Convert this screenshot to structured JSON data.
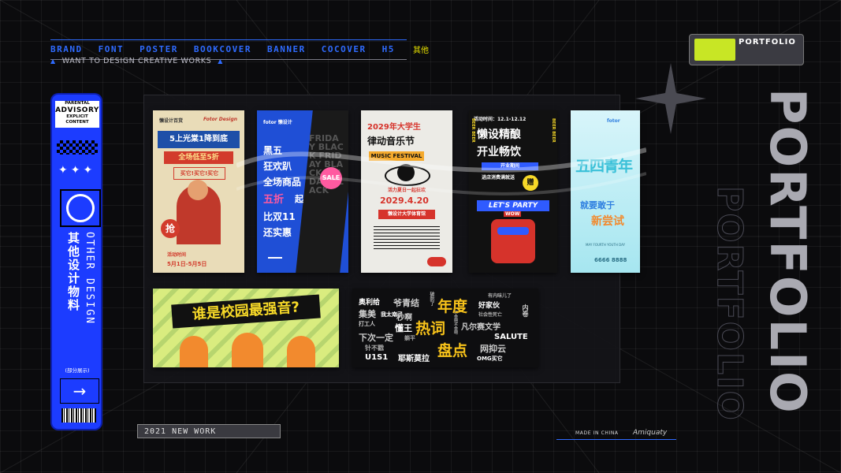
{
  "nav": {
    "items": [
      "BRAND",
      "FONT",
      "POSTER",
      "BOOKCOVER",
      "BANNER",
      "COCOVER",
      "H5"
    ],
    "extra": "其他",
    "tagline": "WANT TO DESIGN CREATIVE WORKS"
  },
  "badge": {
    "title": "PORTFOLIO"
  },
  "left_panel": {
    "advisory_top": "PARENTAL",
    "advisory_main": "ADVISORY",
    "advisory_sub": "EXPLICIT CONTENT",
    "title_cn": "其他设计物料",
    "title_en": "OTHER DESIGN",
    "note": "(部分展示)",
    "arrow": "→"
  },
  "posters": {
    "p1": {
      "brand": "懒设计百货",
      "fotor": "Fotor Design",
      "headline": "5上光棠1降到底",
      "sub": "全场低至5折",
      "tag": "买它!买它!买它",
      "stamp": "抢",
      "footer": "活动时间",
      "date": "5月1日-5月5日"
    },
    "p2": {
      "brand": "fotor 懒设计",
      "l1": "黑五",
      "l2": "狂欢趴",
      "l3": "全场商品",
      "l4": "五折",
      "l4b": "起",
      "l5": "比双11",
      "l6": "还实惠",
      "sale": "SALE",
      "friday": "FRIDAY BLACK FRIDAY BLACK FRIDAY BLACK"
    },
    "p3": {
      "title1": "2029年大学生",
      "title2": "律动音乐节",
      "tag": "MUSIC FESTIVAL",
      "sub": "活力夏日一起狂欢",
      "date": "2029.4.20",
      "venue": "懒设计大学体育馆"
    },
    "p4": {
      "time": "活动时间：12.1-12.12",
      "title1": "懒设精酿",
      "title2": "开业畅饮",
      "sub": "开业期间",
      "offer": "进店消费满就送",
      "gift": "赠",
      "party": "LET'S PARTY",
      "wow": "WOW",
      "beer": "BEER BEER"
    },
    "p5": {
      "brand": "fotor",
      "title": "五四青年",
      "slogan1": "就要敢于",
      "slogan2": "新尝试",
      "footer": "MAY FOURTH YOUTH DAY",
      "phone": "6666 8888"
    },
    "p6": {
      "title": "谁是校园最强音?"
    },
    "p7": {
      "center1": "年度",
      "center2": "热词",
      "center3": "盘点",
      "words": [
        "奥利给",
        "集美",
        "打工人",
        "爷青结",
        "我太南了",
        "秒啊",
        "懂王",
        "好家伙",
        "有内味儿了",
        "凡尔赛文学",
        "SALUTE",
        "下次一定",
        "针不戳",
        "U1S1",
        "耶斯莫拉",
        "网抑云",
        "OMG买它",
        "内卷",
        "社会性死亡",
        "不会吧不会吧",
        "破防了",
        "躺平"
      ]
    }
  },
  "bottom": {
    "newwork": "2021 NEW WORK",
    "made": "MADE IN CHINA",
    "signature": "Amiquaty"
  },
  "side_title": "PORTFOLIO",
  "colors": {
    "accent_blue": "#1c3cff",
    "lime": "#c8e625",
    "background": "#0b0b0d"
  }
}
